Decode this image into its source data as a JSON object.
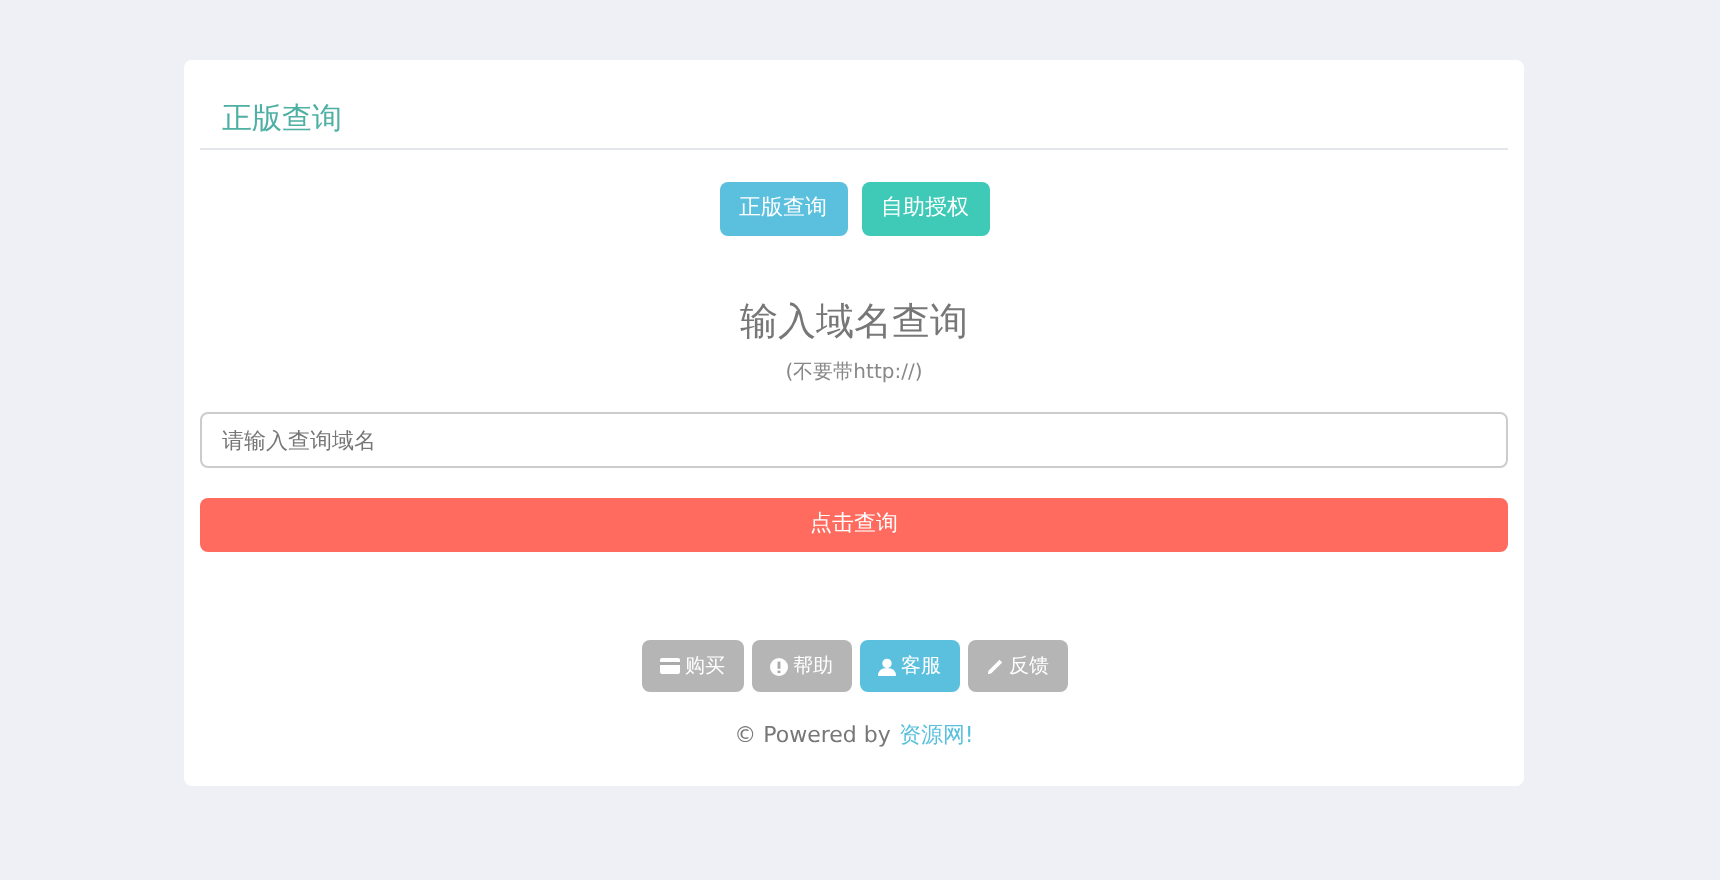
{
  "panel": {
    "title": "正版查询"
  },
  "top_buttons": [
    {
      "label": "正版查询",
      "color": "#5bc0de"
    },
    {
      "label": "自助授权",
      "color": "#3fc9b7"
    }
  ],
  "heading": "输入域名查询",
  "subheading": "(不要带http://)",
  "search": {
    "placeholder": "请输入查询域名"
  },
  "submit": "点击查询",
  "footer_buttons": [
    {
      "label": "购买",
      "kind": "card",
      "selected": false
    },
    {
      "label": "帮助",
      "kind": "info",
      "selected": false
    },
    {
      "label": "客服",
      "kind": "user",
      "selected": true
    },
    {
      "label": "反馈",
      "kind": "pencil",
      "selected": false
    }
  ],
  "powered": {
    "text": "© Powered by",
    "link": "资源网!"
  }
}
